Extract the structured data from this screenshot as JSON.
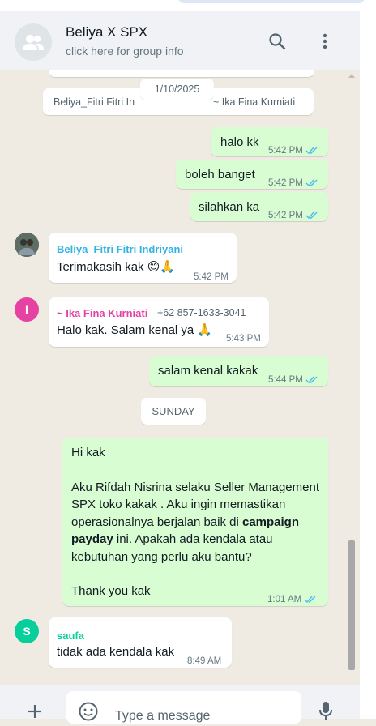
{
  "header": {
    "title": "Beliya X SPX",
    "subtitle": "click here for group info"
  },
  "system": {
    "added_text": "Beliya_Fitri Fitri In",
    "added_text_tail": "~ Ika Fina Kurniati",
    "date_pill": "1/10/2025",
    "sunday_pill": "SUNDAY"
  },
  "messages": {
    "m1": {
      "text": "halo kk",
      "time": "5:42 PM"
    },
    "m2": {
      "text": "boleh banget",
      "time": "5:42 PM"
    },
    "m3": {
      "text": "silahkan ka",
      "time": "5:42 PM"
    },
    "m4": {
      "sender": "Beliya_Fitri Fitri Indriyani",
      "text": "Terimakasih kak 😊🙏",
      "time": "5:42 PM"
    },
    "m5": {
      "sender": "~ Ika Fina Kurniati",
      "phone": "+62 857-1633-3041",
      "text": "Halo kak. Salam kenal ya 🙏",
      "time": "5:43 PM"
    },
    "m6": {
      "text": "salam kenal kakak",
      "time": "5:44 PM"
    },
    "m7": {
      "line1": "Hi kak",
      "line2": "Aku Rifdah Nisrina selaku Seller Management SPX toko kakak . Aku ingin memastikan operasionalnya berjalan baik di",
      "bold": "campaign payday",
      "line3": " ini. Apakah ada kendala atau kebutuhan yang perlu aku bantu?",
      "line4": "Thank you kak",
      "time": "1:01 AM"
    },
    "m8": {
      "sender": "saufa",
      "text": "tidak ada kendala kak",
      "time": "8:49 AM"
    }
  },
  "avatars": {
    "ika_initial": "I",
    "saufa_initial": "S"
  },
  "composer": {
    "placeholder": "Type a message"
  },
  "colors": {
    "outgoing": "#d9fdd3",
    "incoming": "#ffffff",
    "tick_blue": "#53bdeb",
    "beliya_name": "#35b3e0",
    "ika_name": "#e542a3",
    "saufa_name": "#06cf9c"
  }
}
